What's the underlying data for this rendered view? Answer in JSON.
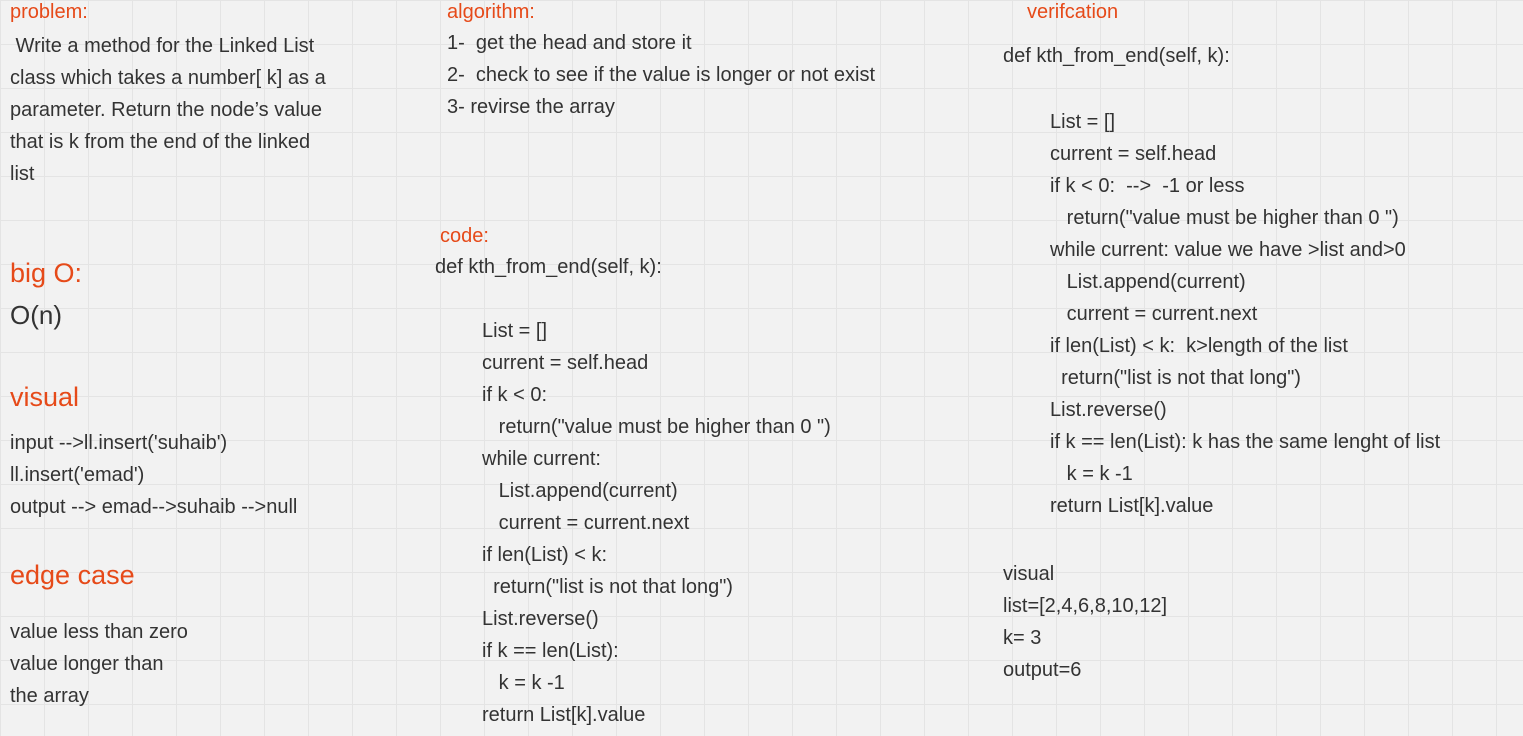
{
  "problem": {
    "label": "problem:",
    "lines": [
      " Write a method for the Linked List",
      "class which takes a number[ k] as a",
      "parameter. Return the node’s value",
      "that is k from the end of the linked",
      "list"
    ]
  },
  "big_o": {
    "heading": "big O:",
    "value": "O(n)"
  },
  "visual": {
    "heading": "visual",
    "lines": [
      "input -->ll.insert('suhaib')",
      "ll.insert('emad')",
      "output --> emad-->suhaib -->null"
    ]
  },
  "edge_case": {
    "heading": "edge case",
    "lines": [
      "value less than zero",
      "value longer than",
      "the array"
    ]
  },
  "algorithm": {
    "label": "algorithm:",
    "lines": [
      "1-  get the head and store it",
      "2-  check to see if the value is longer or not exist",
      "3- revirse the array"
    ]
  },
  "code": {
    "label": "code:",
    "signature": "def kth_from_end(self, k):",
    "lines": [
      "List = []",
      "current = self.head",
      "if k < 0:",
      "   return(\"value must be higher than 0 \")",
      "while current:",
      "   List.append(current)",
      "   current = current.next",
      "if len(List) < k:",
      "  return(\"list is not that long\")",
      "List.reverse()",
      "if k == len(List):",
      "   k = k -1",
      "return List[k].value"
    ]
  },
  "verification": {
    "label": "verifcation",
    "signature": "def kth_from_end(self, k):",
    "lines": [
      "List = []",
      "current = self.head",
      "if k < 0:  -->  -1 or less",
      "   return(\"value must be higher than 0 \")",
      "while current: value we have >list and>0",
      "   List.append(current)",
      "   current = current.next",
      "if len(List) < k:  k>length of the list",
      "  return(\"list is not that long\")",
      "List.reverse()",
      "if k == len(List): k has the same lenght of list",
      "   k = k -1",
      "return List[k].value"
    ],
    "example_lines": [
      "visual",
      "list=[2,4,6,8,10,12]",
      "k= 3",
      "output=6"
    ]
  }
}
